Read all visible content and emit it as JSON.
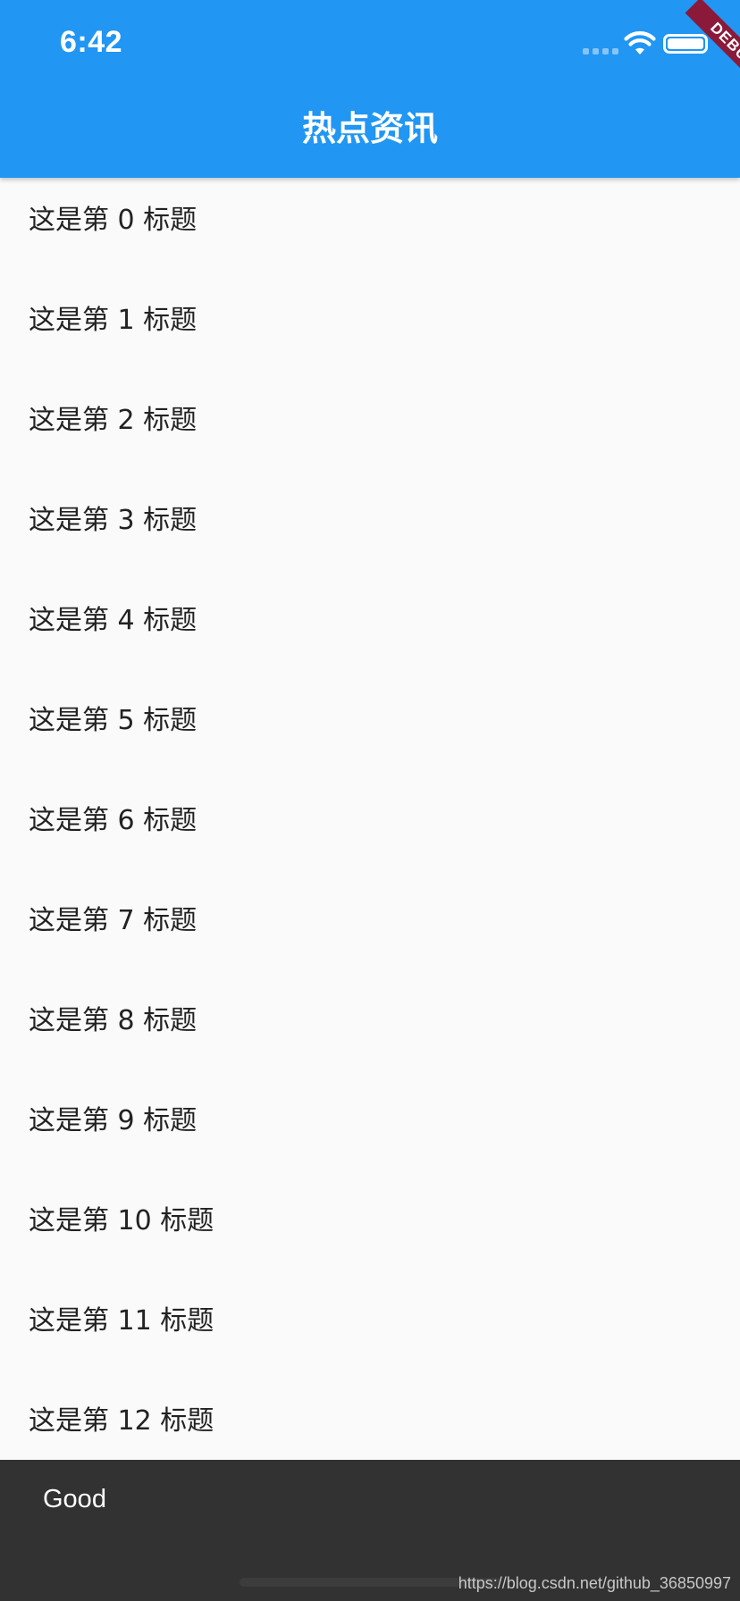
{
  "status_bar": {
    "time": "6:42",
    "icons": [
      "cellular-signal-icon",
      "wifi-icon",
      "battery-icon"
    ]
  },
  "app_bar": {
    "title": "热点资讯",
    "debug_banner": "DEBUG",
    "color": "#2196f3"
  },
  "list": {
    "items": [
      "这是第 0 标题",
      "这是第 1 标题",
      "这是第 2 标题",
      "这是第 3 标题",
      "这是第 4 标题",
      "这是第 5 标题",
      "这是第 6 标题",
      "这是第 7 标题",
      "这是第 8 标题",
      "这是第 9 标题",
      "这是第 10 标题",
      "这是第 11 标题",
      "这是第 12 标题"
    ]
  },
  "snackbar": {
    "message": "Good",
    "color": "#323232"
  },
  "watermark": "https://blog.csdn.net/github_36850997"
}
